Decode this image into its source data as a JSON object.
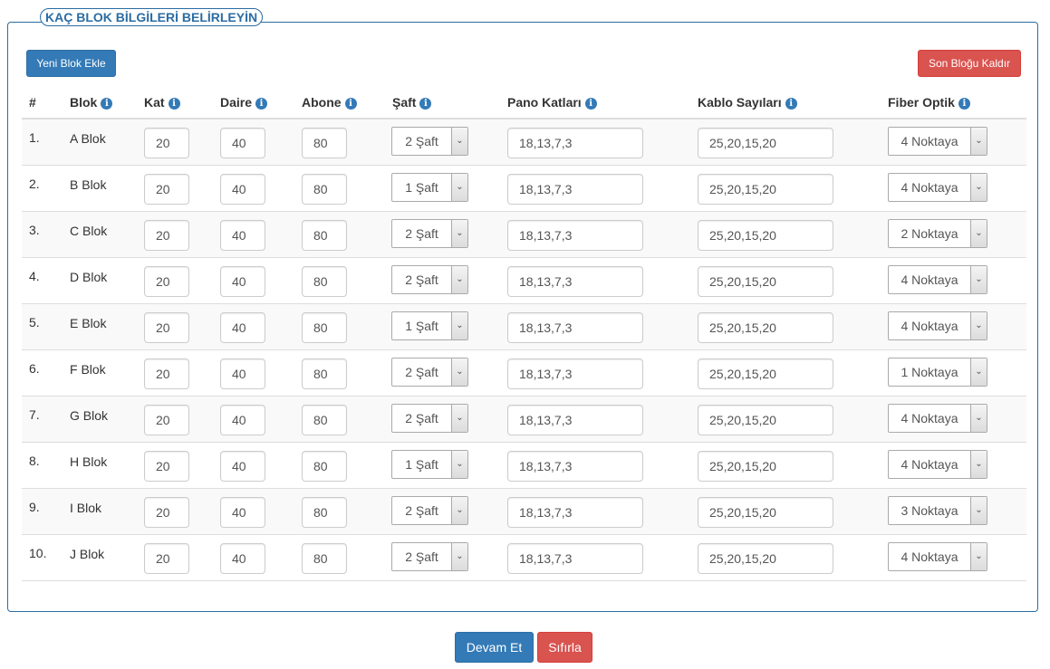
{
  "legend": "KAÇ BLOK BİLGİLERİ BELİRLEYİN",
  "buttons": {
    "add": "Yeni Blok Ekle",
    "remove": "Son Bloğu Kaldır",
    "continue": "Devam Et",
    "reset": "Sıfırla"
  },
  "headers": {
    "num": "#",
    "blok": "Blok",
    "kat": "Kat",
    "daire": "Daire",
    "abone": "Abone",
    "saft": "Şaft",
    "pano": "Pano Katları",
    "kablo": "Kablo Sayıları",
    "fiber": "Fiber Optik"
  },
  "rows": [
    {
      "num": "1.",
      "name": "A Blok",
      "kat": "20",
      "daire": "40",
      "abone": "80",
      "saft": "2 Şaft",
      "pano": "18,13,7,3",
      "kablo": "25,20,15,20",
      "fiber": "4 Noktaya"
    },
    {
      "num": "2.",
      "name": "B Blok",
      "kat": "20",
      "daire": "40",
      "abone": "80",
      "saft": "1 Şaft",
      "pano": "18,13,7,3",
      "kablo": "25,20,15,20",
      "fiber": "4 Noktaya"
    },
    {
      "num": "3.",
      "name": "C Blok",
      "kat": "20",
      "daire": "40",
      "abone": "80",
      "saft": "2 Şaft",
      "pano": "18,13,7,3",
      "kablo": "25,20,15,20",
      "fiber": "2 Noktaya"
    },
    {
      "num": "4.",
      "name": "D Blok",
      "kat": "20",
      "daire": "40",
      "abone": "80",
      "saft": "2 Şaft",
      "pano": "18,13,7,3",
      "kablo": "25,20,15,20",
      "fiber": "4 Noktaya"
    },
    {
      "num": "5.",
      "name": "E Blok",
      "kat": "20",
      "daire": "40",
      "abone": "80",
      "saft": "1 Şaft",
      "pano": "18,13,7,3",
      "kablo": "25,20,15,20",
      "fiber": "4 Noktaya"
    },
    {
      "num": "6.",
      "name": "F Blok",
      "kat": "20",
      "daire": "40",
      "abone": "80",
      "saft": "2 Şaft",
      "pano": "18,13,7,3",
      "kablo": "25,20,15,20",
      "fiber": "1 Noktaya"
    },
    {
      "num": "7.",
      "name": "G Blok",
      "kat": "20",
      "daire": "40",
      "abone": "80",
      "saft": "2 Şaft",
      "pano": "18,13,7,3",
      "kablo": "25,20,15,20",
      "fiber": "4 Noktaya"
    },
    {
      "num": "8.",
      "name": "H Blok",
      "kat": "20",
      "daire": "40",
      "abone": "80",
      "saft": "1 Şaft",
      "pano": "18,13,7,3",
      "kablo": "25,20,15,20",
      "fiber": "4 Noktaya"
    },
    {
      "num": "9.",
      "name": "I Blok",
      "kat": "20",
      "daire": "40",
      "abone": "80",
      "saft": "2 Şaft",
      "pano": "18,13,7,3",
      "kablo": "25,20,15,20",
      "fiber": "3 Noktaya"
    },
    {
      "num": "10.",
      "name": "J Blok",
      "kat": "20",
      "daire": "40",
      "abone": "80",
      "saft": "2 Şaft",
      "pano": "18,13,7,3",
      "kablo": "25,20,15,20",
      "fiber": "4 Noktaya"
    }
  ]
}
